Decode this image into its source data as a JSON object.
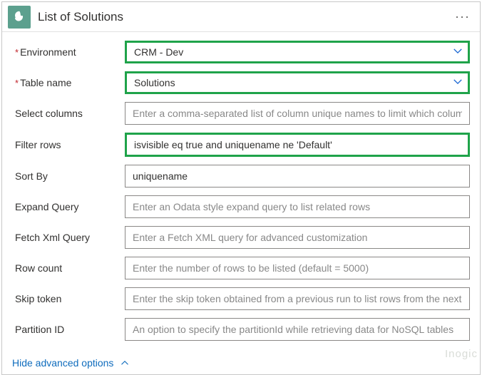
{
  "header": {
    "title": "List of Solutions",
    "menu_icon_name": "more-icon"
  },
  "fields": {
    "environment": {
      "label": "Environment",
      "required": true,
      "value": "CRM - Dev"
    },
    "table_name": {
      "label": "Table name",
      "required": true,
      "value": "Solutions"
    },
    "select_columns": {
      "label": "Select columns",
      "placeholder": "Enter a comma-separated list of column unique names to limit which columns a",
      "value": ""
    },
    "filter_rows": {
      "label": "Filter rows",
      "value": "isvisible eq true and uniquename ne 'Default'"
    },
    "sort_by": {
      "label": "Sort By",
      "value": "uniquename"
    },
    "expand_query": {
      "label": "Expand Query",
      "placeholder": "Enter an Odata style expand query to list related rows",
      "value": ""
    },
    "fetch_xml": {
      "label": "Fetch Xml Query",
      "placeholder": "Enter a Fetch XML query for advanced customization",
      "value": ""
    },
    "row_count": {
      "label": "Row count",
      "placeholder": "Enter the number of rows to be listed (default = 5000)",
      "value": ""
    },
    "skip_token": {
      "label": "Skip token",
      "placeholder": "Enter the skip token obtained from a previous run to list rows from the next pa",
      "value": ""
    },
    "partition_id": {
      "label": "Partition ID",
      "placeholder": "An option to specify the partitionId while retrieving data for NoSQL tables",
      "value": ""
    }
  },
  "footer": {
    "toggle_label": "Hide advanced options"
  },
  "watermark": "Inogic"
}
